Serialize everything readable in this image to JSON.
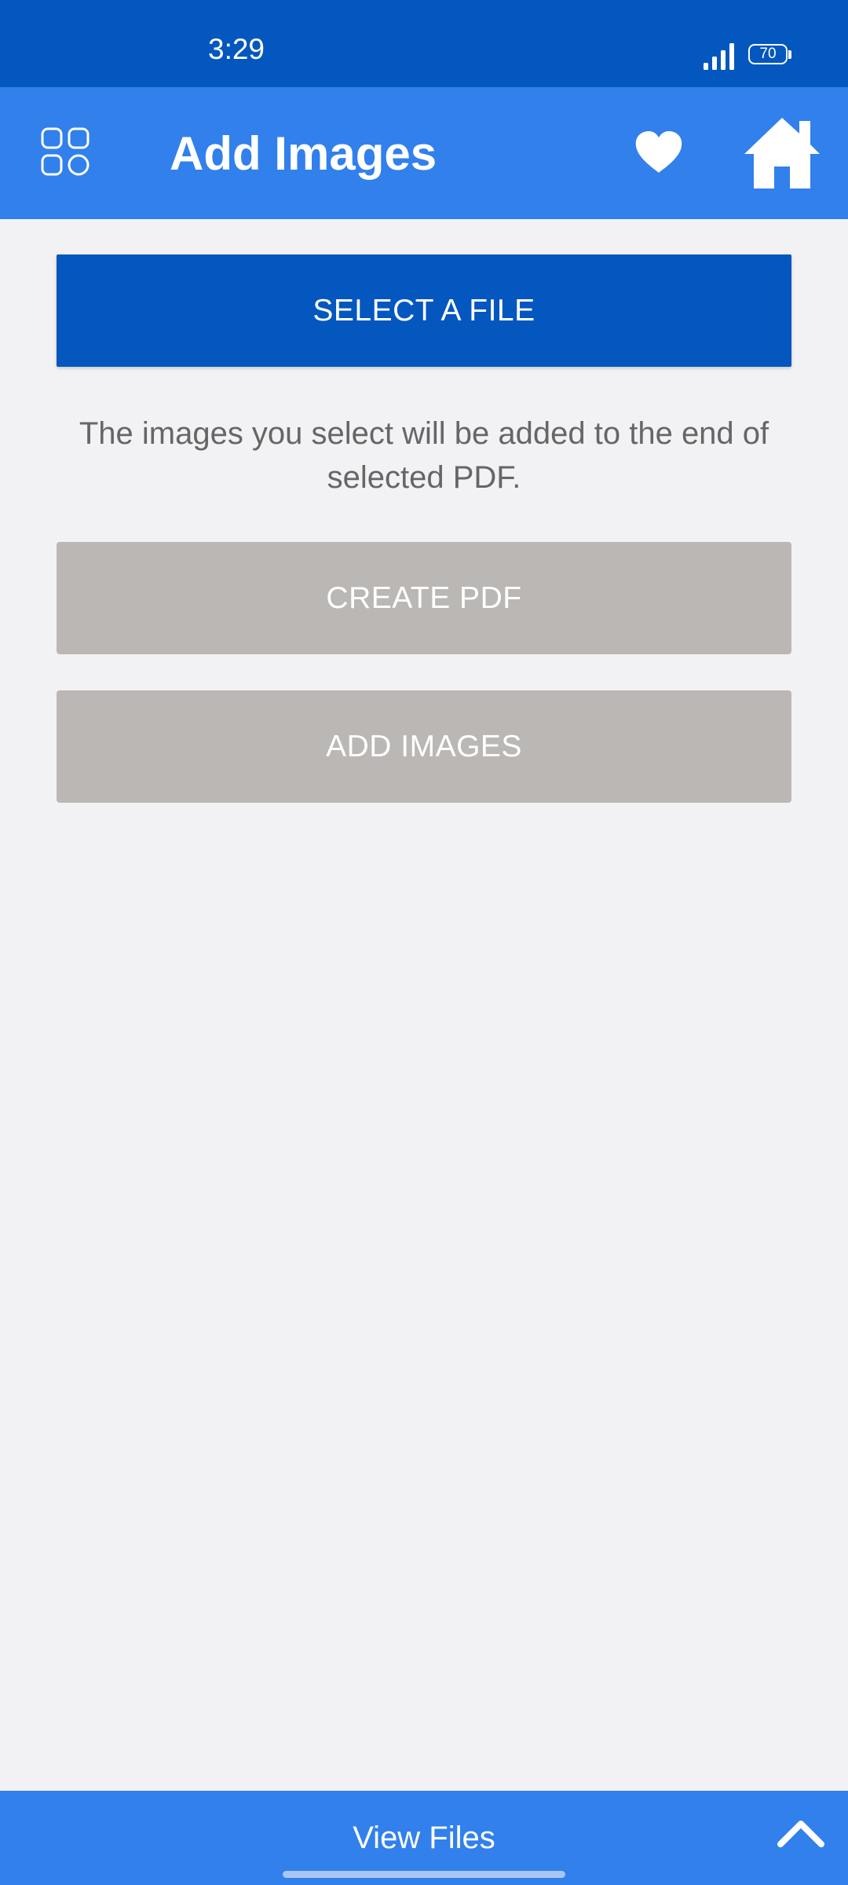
{
  "status_bar": {
    "time": "3:29",
    "battery_level": "70",
    "icons": [
      "signal-icon",
      "battery-icon"
    ]
  },
  "header": {
    "title": "Add Images",
    "icons": [
      "grid-menu-icon",
      "heart-icon",
      "home-icon"
    ]
  },
  "main": {
    "select_button_label": "SELECT A FILE",
    "info_text": "The images you select will be added to the end of selected PDF.",
    "create_button_label": "CREATE PDF",
    "add_button_label": "ADD IMAGES"
  },
  "bottom_bar": {
    "label": "View Files",
    "icon": "chevron-up-icon"
  },
  "colors": {
    "status_bar": "#0457bf",
    "app_bar": "#3180ec",
    "primary_button": "#0457bf",
    "disabled_button": "#bab7b5",
    "background": "#f2f2f4",
    "info_text": "#666666"
  }
}
